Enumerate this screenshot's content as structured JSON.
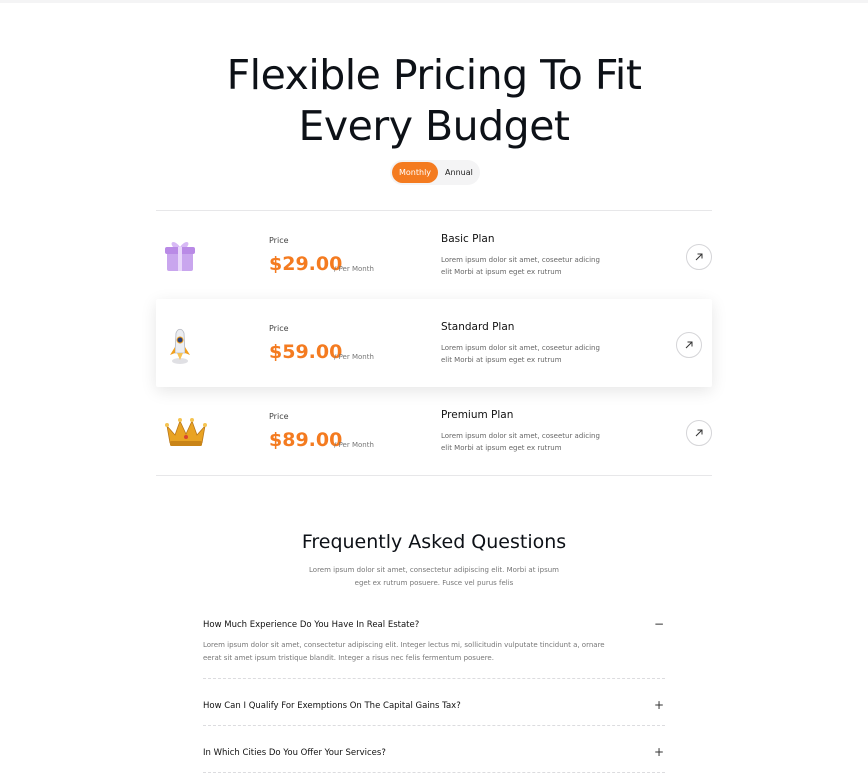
{
  "hero": {
    "title_line1": "Flexible Pricing To Fit",
    "title_line2": "Every Budget"
  },
  "billing_toggle": {
    "options": [
      "Monthly",
      "Annual"
    ],
    "selected": "Monthly"
  },
  "plans": [
    {
      "icon": "gift-icon",
      "price_label": "Price",
      "price": "$29.00",
      "period": "/ Per Month",
      "name": "Basic Plan",
      "description": "Lorem ipsum dolor sit amet, coseetur adicing elit Morbi at ipsum eget ex rutrum"
    },
    {
      "icon": "rocket-icon",
      "price_label": "Price",
      "price": "$59.00",
      "period": "/ Per Month",
      "name": "Standard Plan",
      "description": "Lorem ipsum dolor sit amet, coseetur adicing elit Morbi at ipsum eget ex rutrum"
    },
    {
      "icon": "crown-icon",
      "price_label": "Price",
      "price": "$89.00",
      "period": "/ Per Month",
      "name": "Premium Plan",
      "description": "Lorem ipsum dolor sit amet, coseetur adicing elit Morbi at ipsum eget ex rutrum"
    }
  ],
  "faq": {
    "title": "Frequently Asked Questions",
    "subtitle": "Lorem ipsum dolor sit amet, consectetur adipiscing elit. Morbi at ipsum eget ex rutrum posuere. Fusce vel purus felis",
    "items": [
      {
        "question": "How Much Experience Do You Have In Real Estate?",
        "answer": "Lorem ipsum dolor sit amet, consectetur adipiscing elit. Integer lectus mi, sollicitudin vulputate tincidunt a, ornare eerat sit amet ipsum tristique blandit. Integer a risus nec felis fermentum posuere.",
        "expanded": true,
        "toggle_symbol": "−"
      },
      {
        "question": "How Can I Qualify For Exemptions On The Capital Gains Tax?",
        "answer": "",
        "expanded": false,
        "toggle_symbol": "+"
      },
      {
        "question": "In Which Cities Do You Offer Your Services?",
        "answer": "",
        "expanded": false,
        "toggle_symbol": "+"
      }
    ]
  },
  "colors": {
    "accent": "#f47b20",
    "heading": "#0d1117",
    "muted_text": "#777777",
    "divider": "#e7e7e9"
  }
}
